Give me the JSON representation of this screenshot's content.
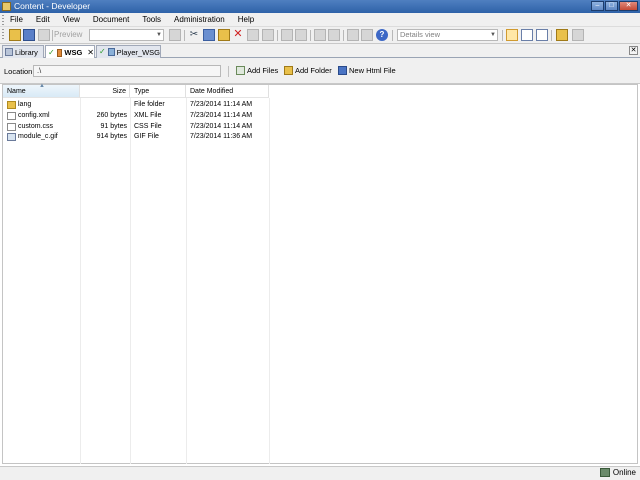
{
  "window": {
    "title": "Content - Developer"
  },
  "menu": [
    "File",
    "Edit",
    "View",
    "Document",
    "Tools",
    "Administration",
    "Help"
  ],
  "toolbar": {
    "preview_label": "Preview",
    "view_mode": "Details view"
  },
  "tabs": [
    {
      "label": "Library"
    },
    {
      "label": "WSG"
    },
    {
      "label": "Player_WSG"
    }
  ],
  "location": {
    "label": "Location:",
    "value": ".\\",
    "actions": [
      "Add Files",
      "Add Folder",
      "New Html File"
    ]
  },
  "list": {
    "columns": [
      "Name",
      "Size",
      "Type",
      "Date Modified"
    ],
    "rows": [
      {
        "name": "lang",
        "size": "",
        "type": "File folder",
        "date": "7/23/2014 11:14 AM",
        "icon": "folder-icon"
      },
      {
        "name": "config.xml",
        "size": "260 bytes",
        "type": "XML File",
        "date": "7/23/2014 11:14 AM",
        "icon": "xml-file-icon"
      },
      {
        "name": "custom.css",
        "size": "91 bytes",
        "type": "CSS File",
        "date": "7/23/2014 11:14 AM",
        "icon": "css-file-icon"
      },
      {
        "name": "module_c.gif",
        "size": "914 bytes",
        "type": "GIF File",
        "date": "7/23/2014 11:36 AM",
        "icon": "gif-file-icon"
      }
    ]
  },
  "status": {
    "text": "Online"
  }
}
